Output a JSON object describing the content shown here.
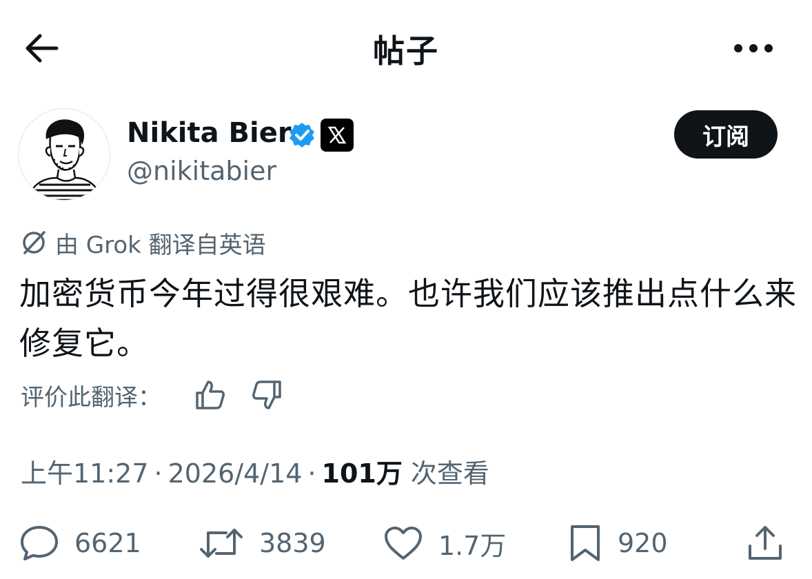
{
  "header": {
    "title": "帖子"
  },
  "author": {
    "name": "Nikita Bier",
    "handle": "@nikitabier",
    "subscribe_label": "订阅"
  },
  "translation": {
    "note": "由 Grok 翻译自英语",
    "rate_label": "评价此翻译："
  },
  "tweet": {
    "text": "加密货币今年过得很艰难。也许我们应该推出点什么来修复它。",
    "time": "上午11:27",
    "date": "2026/4/14",
    "views_count": "101万",
    "views_label": "次查看"
  },
  "actions": {
    "replies": "6621",
    "reposts": "3839",
    "likes": "1.7万",
    "bookmarks": "920"
  },
  "colors": {
    "text_primary": "#0f1419",
    "text_secondary": "#536471",
    "verified_blue": "#1d9bf0"
  }
}
